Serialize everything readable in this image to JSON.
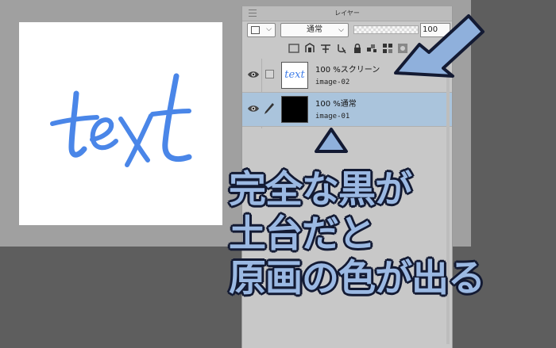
{
  "canvas": {
    "text": "text",
    "text_color": "#4a86e8"
  },
  "panel": {
    "title": "レイヤー",
    "blend_mode": "通常",
    "opacity": "100",
    "layers": [
      {
        "name": "100 %スクリーン",
        "sub": "image-02",
        "thumb_text": "text",
        "selected": false
      },
      {
        "name": "100 %通常",
        "sub": "image-01",
        "thumb_text": "",
        "selected": true
      }
    ]
  },
  "icons": [
    "grip-icon",
    "color-square-icon",
    "chevron-down-icon",
    "clipping-icon",
    "reference-icon",
    "draft-icon",
    "lock-icon",
    "transparency-lock-icon",
    "mask-icon",
    "eye-icon",
    "pen-icon"
  ],
  "caption": {
    "lines": [
      "完全な黒が",
      "土台だと",
      "原画の色が出る"
    ],
    "fill_color": "#9bb9e3",
    "outline_color": "#131a33"
  },
  "arrow_color": "#8fb0dc"
}
